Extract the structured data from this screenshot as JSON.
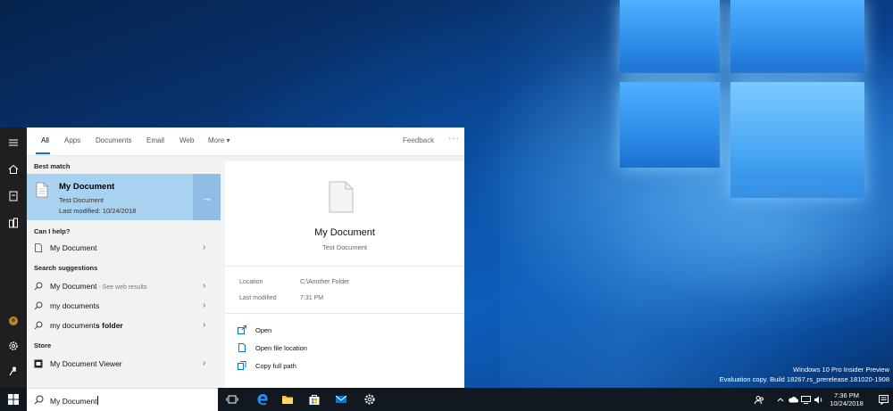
{
  "search": {
    "tabs": [
      "All",
      "Apps",
      "Documents",
      "Email",
      "Web",
      "More ▾"
    ],
    "feedback": "Feedback",
    "more_dots": "···",
    "sections": {
      "best_match": "Best match",
      "can_help": "Can I help?",
      "suggestions": "Search suggestions",
      "store": "Store"
    },
    "best_match": {
      "title": "My Document",
      "type": "Test Document",
      "modified": "Last modified: 10/24/2018"
    },
    "help_item": "My Document",
    "suggestions": [
      {
        "text": "My Document",
        "bold": "",
        "sub": " - See web results"
      },
      {
        "text": "my documents",
        "bold": "",
        "sub": ""
      },
      {
        "text": "my document",
        "bold": "s folder",
        "sub": ""
      }
    ],
    "store_item": "My Document Viewer",
    "query": "My Document"
  },
  "preview": {
    "title": "My Document",
    "type": "Test Document",
    "location_label": "Location",
    "location_value": "C:\\Another Folder",
    "modified_label": "Last modified",
    "modified_value": "7:31 PM",
    "actions": [
      "Open",
      "Open file location",
      "Copy full path"
    ]
  },
  "watermark": {
    "line1": "Windows 10 Pro Insider Preview",
    "line2": "Evaluation copy. Build 18267.rs_prerelease.181020-1908"
  },
  "clock": {
    "time": "7:36 PM",
    "date": "10/24/2018"
  },
  "colors": {
    "accent": "#0078d7",
    "selection": "#a9d1f0",
    "taskbar": "#121820"
  }
}
